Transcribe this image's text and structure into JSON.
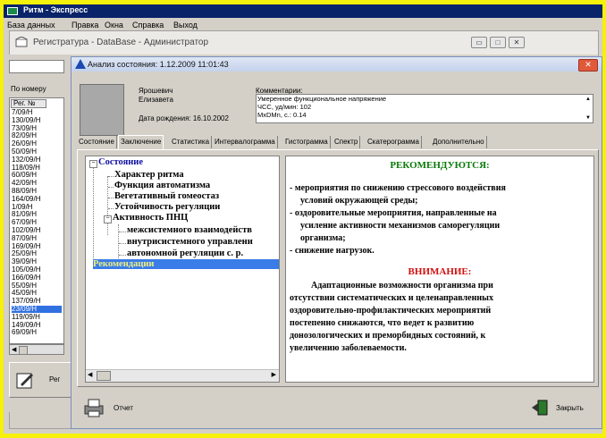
{
  "app_title": "Ритм - Экспресс",
  "menu": [
    "База данных",
    "Правка",
    "Окна",
    "Справка",
    "Выход"
  ],
  "registry": {
    "title": "Регистратура - DataBase - Администратор",
    "sort_label": "По номеру",
    "list_header": "Рег. №",
    "list_items": [
      "7/09/H",
      "130/09/H",
      "73/09/H",
      "82/09/H",
      "26/09/H",
      "50/09/H",
      "132/09/H",
      "118/09/H",
      "60/09/H",
      "42/09/H",
      "88/09/H",
      "164/09/H",
      "1/09/H",
      "81/09/H",
      "67/09/H",
      "102/09/H",
      "87/09/H",
      "169/09/H",
      "25/09/H",
      "39/09/H",
      "105/09/H",
      "166/09/H",
      "55/09/H",
      "45/09/H",
      "137/09/H",
      "23/09/H",
      "119/09/H",
      "149/09/H",
      "69/09/H"
    ],
    "selected_index": 25,
    "bottom_button_label": "Рег"
  },
  "analysis": {
    "title": "Анализ состояния: 1.12.2009 11:01:43",
    "patient_surname": "Ярошевич",
    "patient_name": "Елизавета",
    "birth_label": "Дата рождения: 16.10.2002",
    "comment_label": "Комментарии:",
    "comment_lines": [
      "Умеренное функциональное напряжение",
      "ЧСС, уд/мин:  102",
      "MxDMn, с.:  0.14"
    ]
  },
  "tabs": [
    "Состояние",
    "Заключение",
    "Статистика",
    "Интервалограмма",
    "Гистограмма",
    "Спектр",
    "Скатерограмма",
    "Дополнительно"
  ],
  "active_tab": "Заключение",
  "tree": {
    "root": "Состояние",
    "children": [
      "Характер ритма",
      "Функция автоматизма",
      "Вегетативный гомеостаз",
      "Устойчивость регуляции",
      "Активность ПНЦ"
    ],
    "sub_children": [
      "межсистемного взаимодейств",
      "внутрисистемного управлени",
      "автономной регуляции с. р."
    ],
    "selected": "Рекомендации"
  },
  "recommendations": {
    "heading": "РЕКОМЕНДУЮТСЯ:",
    "lines": [
      "- мероприятия по снижению стрессового воздействия",
      "условий окружающей среды;",
      "- оздоровительные мероприятия, направленные на",
      "усиление активности механизмов саморегуляции",
      "организма;",
      "- снижение нагрузок."
    ],
    "warning_heading": "ВНИМАНИЕ:",
    "warning_lines": [
      "Адаптационные возможности организма при",
      "отсутствии систематических и целенаправленных",
      "оздоровительно-профилактических мероприятий",
      "постепенно снижаются, что ведет к развитию",
      "донозологических и преморбидных состояний, к",
      "увеличению заболеваемости."
    ]
  },
  "buttons": {
    "report": "Отчет",
    "close": "Закрыть"
  },
  "colors": {
    "title_bar": "#0a246a",
    "selection": "#3070e0",
    "heading_green": "#0a7a0a",
    "warning_red": "#d01010",
    "frame_yellow": "#f5f10a"
  }
}
